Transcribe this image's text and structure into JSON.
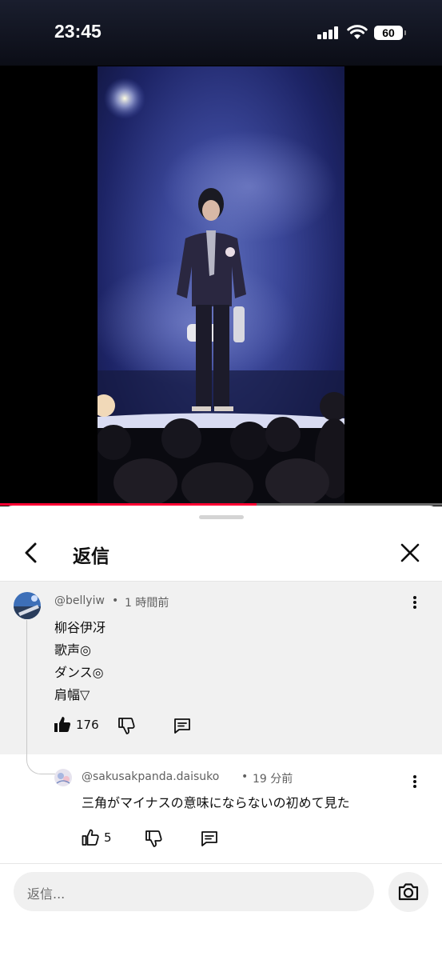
{
  "status_bar": {
    "time": "23:45",
    "battery": "60"
  },
  "video": {
    "progress_fraction": 0.58
  },
  "header": {
    "title": "返信"
  },
  "parent_comment": {
    "author": "@bellyiw",
    "time": "1 時間前",
    "lines": [
      "柳谷伊冴",
      "歌声◎",
      "ダンス◎",
      "肩幅▽"
    ],
    "likes": "176"
  },
  "reply": {
    "author": "@sakusakpanda.daisuko",
    "time": "19 分前",
    "text": "三角がマイナスの意味にならないの初めて見た",
    "likes": "5"
  },
  "reply_input": {
    "placeholder": "返信..."
  },
  "icons": {
    "back": "chevron-left-icon",
    "close": "close-icon",
    "more": "more-vert-icon",
    "like": "thumb-up-icon",
    "dislike": "thumb-down-icon",
    "reply": "comment-icon",
    "camera": "camera-icon"
  }
}
